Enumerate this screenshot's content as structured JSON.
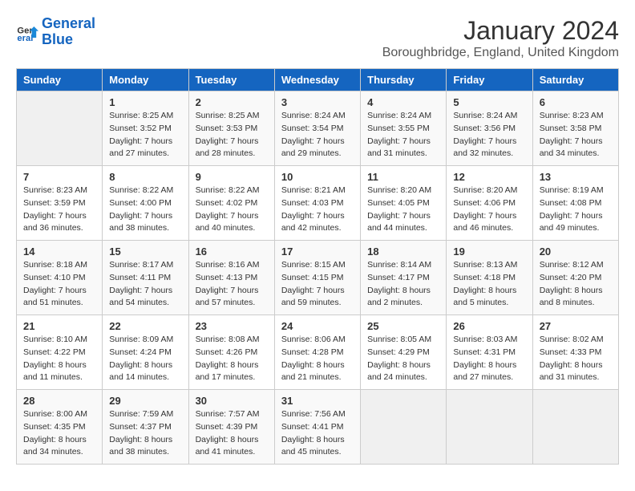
{
  "header": {
    "logo_line1": "General",
    "logo_line2": "Blue",
    "title": "January 2024",
    "subtitle": "Boroughbridge, England, United Kingdom"
  },
  "days_of_week": [
    "Sunday",
    "Monday",
    "Tuesday",
    "Wednesday",
    "Thursday",
    "Friday",
    "Saturday"
  ],
  "weeks": [
    [
      {
        "num": "",
        "info": ""
      },
      {
        "num": "1",
        "info": "Sunrise: 8:25 AM\nSunset: 3:52 PM\nDaylight: 7 hours\nand 27 minutes."
      },
      {
        "num": "2",
        "info": "Sunrise: 8:25 AM\nSunset: 3:53 PM\nDaylight: 7 hours\nand 28 minutes."
      },
      {
        "num": "3",
        "info": "Sunrise: 8:24 AM\nSunset: 3:54 PM\nDaylight: 7 hours\nand 29 minutes."
      },
      {
        "num": "4",
        "info": "Sunrise: 8:24 AM\nSunset: 3:55 PM\nDaylight: 7 hours\nand 31 minutes."
      },
      {
        "num": "5",
        "info": "Sunrise: 8:24 AM\nSunset: 3:56 PM\nDaylight: 7 hours\nand 32 minutes."
      },
      {
        "num": "6",
        "info": "Sunrise: 8:23 AM\nSunset: 3:58 PM\nDaylight: 7 hours\nand 34 minutes."
      }
    ],
    [
      {
        "num": "7",
        "info": "Sunrise: 8:23 AM\nSunset: 3:59 PM\nDaylight: 7 hours\nand 36 minutes."
      },
      {
        "num": "8",
        "info": "Sunrise: 8:22 AM\nSunset: 4:00 PM\nDaylight: 7 hours\nand 38 minutes."
      },
      {
        "num": "9",
        "info": "Sunrise: 8:22 AM\nSunset: 4:02 PM\nDaylight: 7 hours\nand 40 minutes."
      },
      {
        "num": "10",
        "info": "Sunrise: 8:21 AM\nSunset: 4:03 PM\nDaylight: 7 hours\nand 42 minutes."
      },
      {
        "num": "11",
        "info": "Sunrise: 8:20 AM\nSunset: 4:05 PM\nDaylight: 7 hours\nand 44 minutes."
      },
      {
        "num": "12",
        "info": "Sunrise: 8:20 AM\nSunset: 4:06 PM\nDaylight: 7 hours\nand 46 minutes."
      },
      {
        "num": "13",
        "info": "Sunrise: 8:19 AM\nSunset: 4:08 PM\nDaylight: 7 hours\nand 49 minutes."
      }
    ],
    [
      {
        "num": "14",
        "info": "Sunrise: 8:18 AM\nSunset: 4:10 PM\nDaylight: 7 hours\nand 51 minutes."
      },
      {
        "num": "15",
        "info": "Sunrise: 8:17 AM\nSunset: 4:11 PM\nDaylight: 7 hours\nand 54 minutes."
      },
      {
        "num": "16",
        "info": "Sunrise: 8:16 AM\nSunset: 4:13 PM\nDaylight: 7 hours\nand 57 minutes."
      },
      {
        "num": "17",
        "info": "Sunrise: 8:15 AM\nSunset: 4:15 PM\nDaylight: 7 hours\nand 59 minutes."
      },
      {
        "num": "18",
        "info": "Sunrise: 8:14 AM\nSunset: 4:17 PM\nDaylight: 8 hours\nand 2 minutes."
      },
      {
        "num": "19",
        "info": "Sunrise: 8:13 AM\nSunset: 4:18 PM\nDaylight: 8 hours\nand 5 minutes."
      },
      {
        "num": "20",
        "info": "Sunrise: 8:12 AM\nSunset: 4:20 PM\nDaylight: 8 hours\nand 8 minutes."
      }
    ],
    [
      {
        "num": "21",
        "info": "Sunrise: 8:10 AM\nSunset: 4:22 PM\nDaylight: 8 hours\nand 11 minutes."
      },
      {
        "num": "22",
        "info": "Sunrise: 8:09 AM\nSunset: 4:24 PM\nDaylight: 8 hours\nand 14 minutes."
      },
      {
        "num": "23",
        "info": "Sunrise: 8:08 AM\nSunset: 4:26 PM\nDaylight: 8 hours\nand 17 minutes."
      },
      {
        "num": "24",
        "info": "Sunrise: 8:06 AM\nSunset: 4:28 PM\nDaylight: 8 hours\nand 21 minutes."
      },
      {
        "num": "25",
        "info": "Sunrise: 8:05 AM\nSunset: 4:29 PM\nDaylight: 8 hours\nand 24 minutes."
      },
      {
        "num": "26",
        "info": "Sunrise: 8:03 AM\nSunset: 4:31 PM\nDaylight: 8 hours\nand 27 minutes."
      },
      {
        "num": "27",
        "info": "Sunrise: 8:02 AM\nSunset: 4:33 PM\nDaylight: 8 hours\nand 31 minutes."
      }
    ],
    [
      {
        "num": "28",
        "info": "Sunrise: 8:00 AM\nSunset: 4:35 PM\nDaylight: 8 hours\nand 34 minutes."
      },
      {
        "num": "29",
        "info": "Sunrise: 7:59 AM\nSunset: 4:37 PM\nDaylight: 8 hours\nand 38 minutes."
      },
      {
        "num": "30",
        "info": "Sunrise: 7:57 AM\nSunset: 4:39 PM\nDaylight: 8 hours\nand 41 minutes."
      },
      {
        "num": "31",
        "info": "Sunrise: 7:56 AM\nSunset: 4:41 PM\nDaylight: 8 hours\nand 45 minutes."
      },
      {
        "num": "",
        "info": ""
      },
      {
        "num": "",
        "info": ""
      },
      {
        "num": "",
        "info": ""
      }
    ]
  ]
}
